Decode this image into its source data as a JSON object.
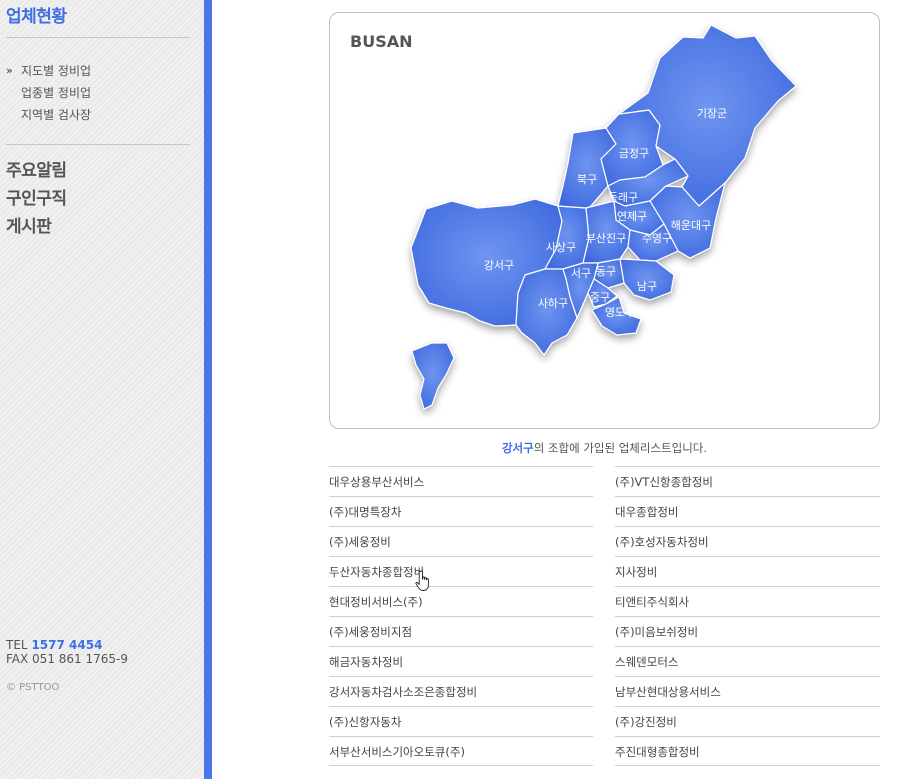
{
  "sidebar": {
    "title": "업체현황",
    "submenu": [
      {
        "label": "지도별 정비업",
        "active": true
      },
      {
        "label": "업종별 정비업",
        "active": false
      },
      {
        "label": "지역별 검사장",
        "active": false
      }
    ],
    "main_menu": [
      "주요알림",
      "구인구직",
      "게시판"
    ],
    "contact": {
      "tel_label": "TEL",
      "tel_number": "1577 4454",
      "fax": "FAX 051 861 1765-9"
    },
    "copyright": "© PSTTOO"
  },
  "map": {
    "title": "BUSAN",
    "districts": [
      "기장군",
      "금정구",
      "북구",
      "동래구",
      "연제구",
      "해운대구",
      "부산진구",
      "수영구",
      "사상구",
      "강서구",
      "서구",
      "동구",
      "남구",
      "중구",
      "사하구",
      "영도구"
    ],
    "colors": {
      "land": "#4a78e8",
      "border": "#ffffff",
      "accent": "#3f6fe2"
    }
  },
  "list": {
    "selected_district": "강서구",
    "caption_rest": "의 조합에 가입된 업체리스트입니다.",
    "left": [
      "대우상용부산서비스",
      "(주)대명특장차",
      "(주)세웅정비",
      "두산자동차종합정비",
      "현대정비서비스(주)",
      "(주)세웅정비지점",
      "해금자동차정비",
      "강서자동차검사소조은종합정비",
      "(주)신항자동차",
      "서부산서비스기아오토큐(주)"
    ],
    "right": [
      "(주)VT신항종합정비",
      "대우종합정비",
      "(주)호성자동차정비",
      "지사정비",
      "티앤티주식회사",
      "(주)미음보쉬정비",
      "스웨덴모터스",
      "남부산현대상용서비스",
      "(주)강진정비",
      "주진대형종합정비"
    ]
  }
}
